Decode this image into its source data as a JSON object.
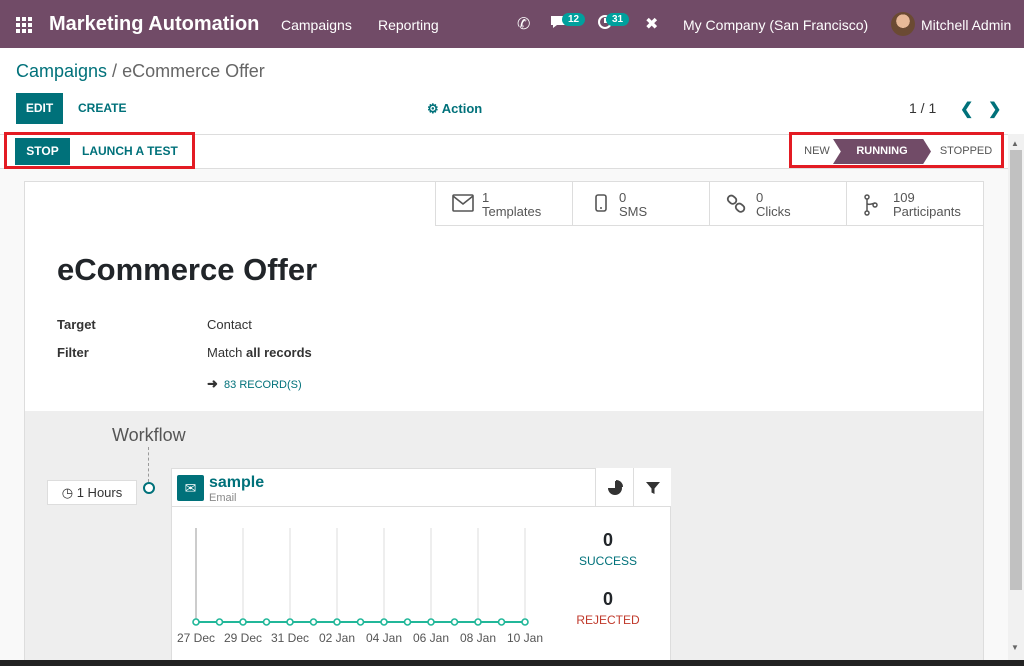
{
  "navbar": {
    "app_title": "Marketing Automation",
    "menus": [
      "Campaigns",
      "Reporting"
    ],
    "messages_count": "12",
    "activities_count": "31",
    "company": "My Company (San Francisco)",
    "user": "Mitchell Admin",
    "bg_color": "#714b67"
  },
  "breadcrumb": {
    "parent": "Campaigns",
    "separator": " / ",
    "current": "eCommerce Offer"
  },
  "toolbar": {
    "edit_label": "EDIT",
    "create_label": "CREATE",
    "action_label": "Action",
    "pager": "1 / 1"
  },
  "statusbar": {
    "stop_label": "STOP",
    "test_label": "LAUNCH A TEST",
    "stages": [
      "NEW",
      "RUNNING",
      "STOPPED"
    ],
    "active_stage": "RUNNING"
  },
  "stats": [
    {
      "value": "1",
      "label": "Templates",
      "icon": "envelope-icon"
    },
    {
      "value": "0",
      "label": "SMS",
      "icon": "mobile-icon"
    },
    {
      "value": "0",
      "label": "Clicks",
      "icon": "link-icon"
    },
    {
      "value": "109",
      "label": "Participants",
      "icon": "code-fork-icon"
    }
  ],
  "form": {
    "title": "eCommerce Offer",
    "target_label": "Target",
    "target_value": "Contact",
    "filter_label": "Filter",
    "filter_prefix": "Match ",
    "filter_value": "all records",
    "records_link": "83 RECORD(S)"
  },
  "workflow": {
    "title": "Workflow",
    "trigger": "1 Hours",
    "activity": {
      "name": "sample",
      "type": "Email",
      "success_count": "0",
      "success_label": "SUCCESS",
      "rejected_count": "0",
      "rejected_label": "REJECTED"
    }
  },
  "chart_data": {
    "type": "line",
    "x": [
      "27 Dec",
      "28 Dec",
      "29 Dec",
      "30 Dec",
      "31 Dec",
      "01 Jan",
      "02 Jan",
      "03 Jan",
      "04 Jan",
      "05 Jan",
      "06 Jan",
      "07 Jan",
      "08 Jan",
      "09 Jan",
      "10 Jan"
    ],
    "tick_labels": [
      "27 Dec",
      "29 Dec",
      "31 Dec",
      "02 Jan",
      "04 Jan",
      "06 Jan",
      "08 Jan",
      "10 Jan"
    ],
    "series": [
      {
        "values": [
          0,
          0,
          0,
          0,
          0,
          0,
          0,
          0,
          0,
          0,
          0,
          0,
          0,
          0,
          0
        ],
        "color": "#21b799"
      }
    ],
    "grid": true
  }
}
